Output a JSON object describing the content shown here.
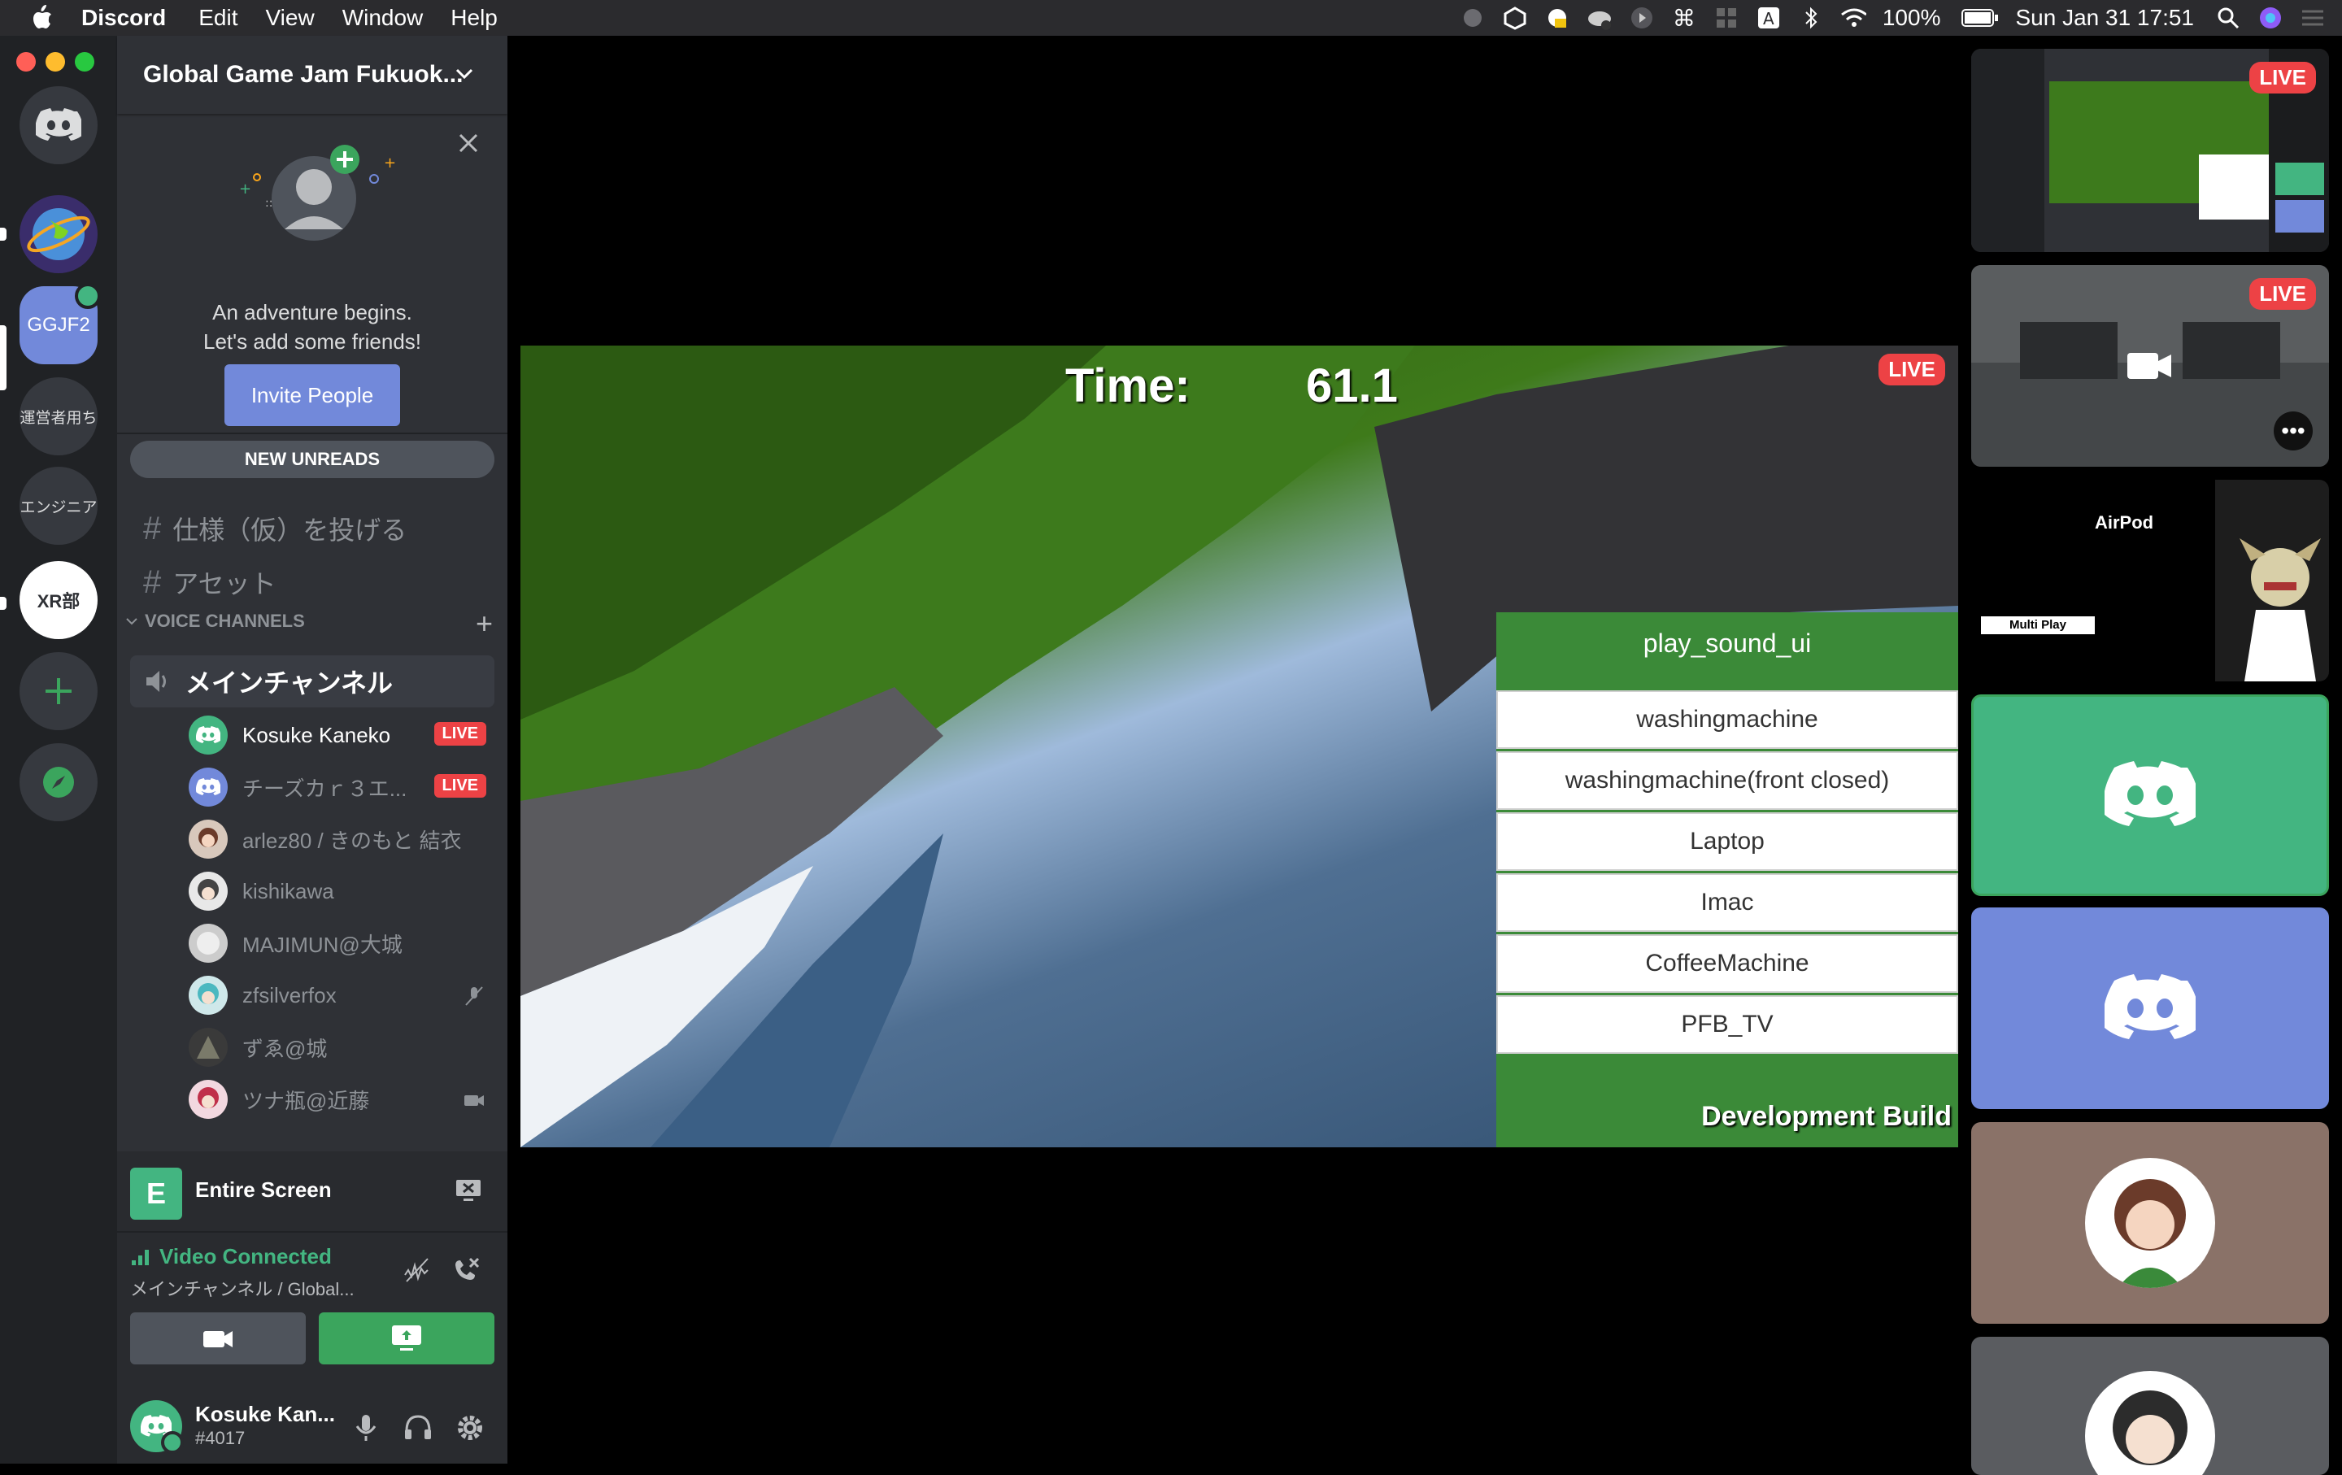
{
  "menubar": {
    "app_name": "Discord",
    "menus": [
      "Edit",
      "View",
      "Window",
      "Help"
    ],
    "battery": "100%",
    "datetime": "Sun Jan 31  17:51"
  },
  "servers": {
    "active_label": "GGJF2",
    "text_server_1": "運営者用ち",
    "text_server_2": "エンジニア",
    "club_label": "XR部"
  },
  "server_header": {
    "title": "Global Game Jam Fukuok..."
  },
  "friends_card": {
    "line1": "An adventure begins.",
    "line2": "Let's add some friends!",
    "invite_label": "Invite People"
  },
  "new_unreads": "NEW UNREADS",
  "text_channels": [
    {
      "name": "仕様（仮）を投げる"
    },
    {
      "name": "アセット"
    }
  ],
  "voice_section": {
    "header": "VOICE CHANNELS",
    "channel_name": "メインチャンネル",
    "users": [
      {
        "name": "Kosuke Kaneko",
        "live": "LIVE"
      },
      {
        "name": "チーズカｒ３エ...",
        "live": "LIVE"
      },
      {
        "name": "arlez80 / きのもと 結衣"
      },
      {
        "name": "kishikawa"
      },
      {
        "name": "MAJIMUN@大城"
      },
      {
        "name": "zfsilverfox"
      },
      {
        "name": "ずゑ@城"
      },
      {
        "name": "ツナ瓶@近藤"
      }
    ]
  },
  "screen_share": {
    "thumb_letter": "E",
    "label": "Entire Screen"
  },
  "voice_status": {
    "status": "Video Connected",
    "channel": "メインチャンネル / Global..."
  },
  "user_panel": {
    "name": "Kosuke Kan...",
    "tag": "#4017"
  },
  "stream": {
    "time_label": "Time:",
    "time_value": "61.1",
    "live": "LIVE",
    "menu_title": "play_sound_ui",
    "menu_options": [
      "washingmachine",
      "washingmachine(front closed)",
      "Laptop",
      "Imac",
      "CoffeeMachine",
      "PFB_TV"
    ],
    "build_label": "Development Build"
  },
  "tiles": {
    "live": "LIVE",
    "airpods_label": "AirPod",
    "multiplay_label": "Multi Play"
  },
  "colors": {
    "blurple": "#7289da",
    "green": "#43b581",
    "live_red": "#ed4245"
  }
}
